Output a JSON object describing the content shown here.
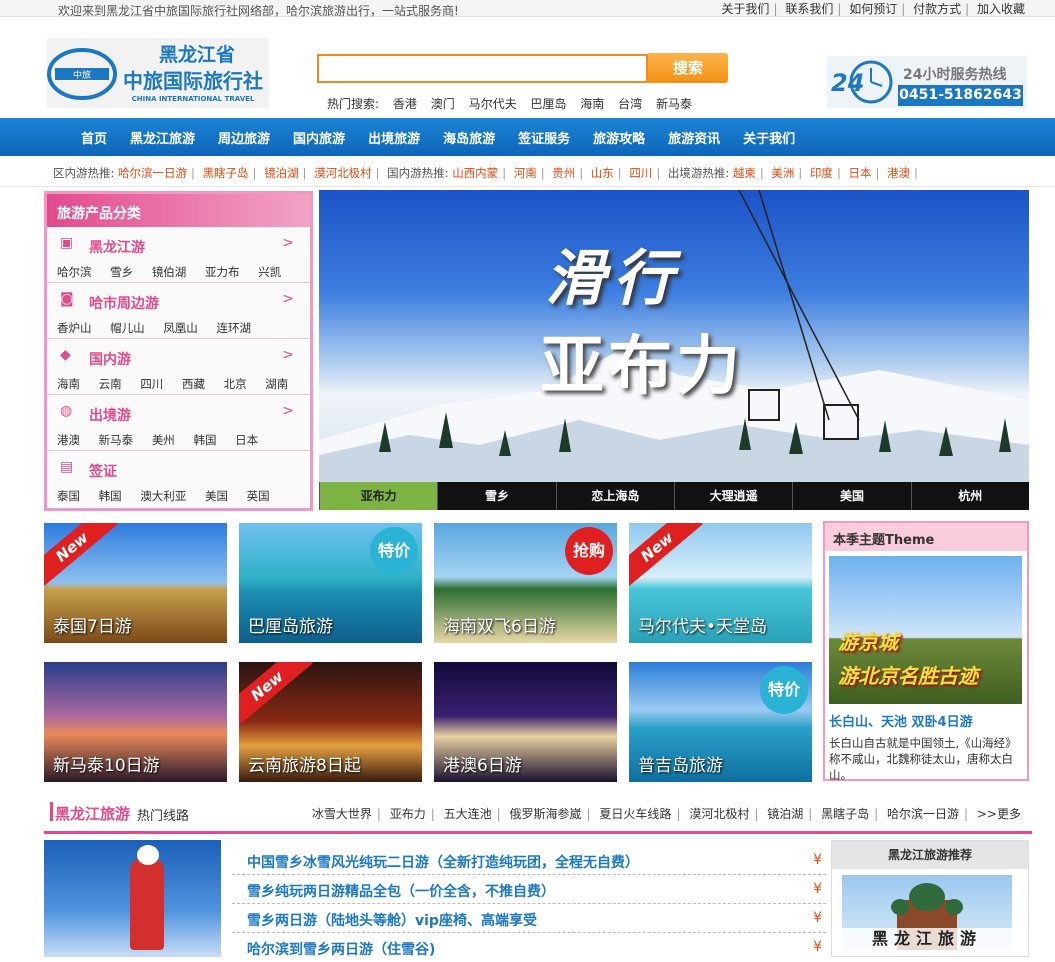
{
  "topbar": {
    "welcome": "欢迎来到黑龙江省中旅国际旅行社网络部，哈尔滨旅游出行，一站式服务商!",
    "links": [
      "关于我们",
      "联系我们",
      "如何预订",
      "付款方式",
      "加入收藏"
    ]
  },
  "logo": {
    "cn_line1": "黑龙江省",
    "cn_line2": "中旅国际旅行社",
    "en": "CHINA INTERNATIONAL TRAVEL",
    "emblem": "中旅"
  },
  "search": {
    "placeholder": "",
    "button": "搜索",
    "hot_label": "热门搜索:",
    "hot": [
      "香港",
      "澳门",
      "马尔代夫",
      "巴厘岛",
      "海南",
      "台湾",
      "新马泰"
    ]
  },
  "hotline": {
    "badge": "24",
    "label": "24小时服务热线",
    "number": "0451-51862643"
  },
  "nav": [
    "首页",
    "黑龙江旅游",
    "周边旅游",
    "国内旅游",
    "出境旅游",
    "海岛旅游",
    "签证服务",
    "旅游攻略",
    "旅游资讯",
    "关于我们"
  ],
  "rec": {
    "local_label": "区内游热推:",
    "local": [
      "哈尔滨一日游",
      "黑瞎子岛",
      "镜泊湖",
      "漠河北极村"
    ],
    "domestic_label": "国内游热推:",
    "domestic": [
      "山西内蒙",
      "河南",
      "贵州",
      "山东",
      "四川"
    ],
    "abroad_label": "出境游热推:",
    "abroad": [
      "越柬",
      "美洲",
      "印度",
      "日本",
      "港澳"
    ]
  },
  "sidebar": {
    "title": "旅游产品分类",
    "cats": [
      {
        "title": "黑龙江游",
        "icon": "bus-icon",
        "subs": [
          "哈尔滨",
          "雪乡",
          "镜伯湖",
          "亚力布",
          "兴凯"
        ]
      },
      {
        "title": "哈市周边游",
        "icon": "car-icon",
        "subs": [
          "香炉山",
          "帽儿山",
          "凤凰山",
          "连环湖"
        ]
      },
      {
        "title": "国内游",
        "icon": "china-map-icon",
        "subs": [
          "海南",
          "云南",
          "四川",
          "西藏",
          "北京",
          "湖南"
        ]
      },
      {
        "title": "出境游",
        "icon": "world-map-icon",
        "subs": [
          "港澳",
          "新马泰",
          "美州",
          "韩国",
          "日本"
        ]
      },
      {
        "title": "签证",
        "icon": "passport-icon",
        "subs": [
          "泰国",
          "韩国",
          "澳大利亚",
          "美国",
          "英国"
        ]
      }
    ],
    "arrow": ">"
  },
  "banner": {
    "title1": "滑行",
    "title2": "亚布力",
    "tabs": [
      "亚布力",
      "雪乡",
      "恋上海岛",
      "大理逍遥",
      "美国",
      "杭州"
    ],
    "active": 0
  },
  "tours": [
    {
      "caption": "泰国7日游",
      "badge": "New",
      "badge_type": "new"
    },
    {
      "caption": "巴厘岛旅游",
      "badge": "特价",
      "badge_type": "sale"
    },
    {
      "caption": "海南双飞6日游",
      "badge": "抢购",
      "badge_type": "rush"
    },
    {
      "caption": "马尔代夫•天堂岛",
      "badge": "New",
      "badge_type": "new"
    },
    {
      "caption": "新马泰10日游",
      "badge": "",
      "badge_type": "none"
    },
    {
      "caption": "云南旅游8日起",
      "badge": "New",
      "badge_type": "new"
    },
    {
      "caption": "港澳6日游",
      "badge": "",
      "badge_type": "none"
    },
    {
      "caption": "普吉岛旅游",
      "badge": "特价",
      "badge_type": "sale"
    }
  ],
  "theme": {
    "title": "本季主题Theme",
    "img_text1": "游京城",
    "img_text2": "游北京名胜古迹",
    "tour_title": "长白山、天池 双卧4日游",
    "tour_desc": "长白山自古就是中国领土,《山海经》称不咸山，北魏称徒太山，唐称太白山。"
  },
  "section": {
    "title": "黑龙江旅游",
    "subtitle": "热门线路",
    "links": [
      "冰雪大世界",
      "亚布力",
      "五大连池",
      "俄罗斯海参崴",
      "夏日火车线路",
      "漠河北极村",
      "镜泊湖",
      "黑瞎子岛",
      "哈尔滨一日游",
      ">>更多"
    ],
    "routes": [
      "中国雪乡冰雪风光纯玩二日游（全新打造纯玩团，全程无自费）",
      "雪乡纯玩两日游精品全包（一价全含，不推自费）",
      "雪乡两日游（陆地头等舱）vip座椅、高端享受",
      "哈尔滨到雪乡两日游（住雪谷)"
    ],
    "yen": "¥",
    "rec_title": "黑龙江旅游推荐",
    "rec_caption": "黑龙江旅游"
  },
  "colors": {
    "nav": "#0e65b8",
    "accent_pink": "#e8468e",
    "accent_orange": "#f39214",
    "link_blue": "#1c78c3"
  }
}
